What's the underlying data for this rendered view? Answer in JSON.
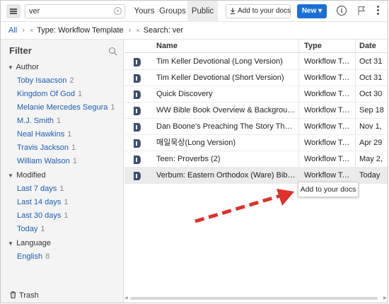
{
  "search": {
    "value": "ver"
  },
  "tabs": [
    {
      "label": "Yours",
      "active": false
    },
    {
      "label": "Groups",
      "active": false
    },
    {
      "label": "Public",
      "active": true
    }
  ],
  "toolbar": {
    "add_docs_label": "Add to your docs",
    "new_label": "New ▾",
    "info_glyph": "i",
    "accent_color": "#1a6fd6"
  },
  "breadcrumb": {
    "root": "All",
    "sep": "›",
    "filter_type": "Type: Workflow Template",
    "filter_search": "Search: ver",
    "remove_glyph": "×"
  },
  "sidebar": {
    "title": "Filter",
    "groups": [
      {
        "label": "Author",
        "items": [
          {
            "label": "Toby Isaacson",
            "count": "2"
          },
          {
            "label": "Kingdom Of God",
            "count": "1"
          },
          {
            "label": "Melanie  Mercedes Segura",
            "count": "1"
          },
          {
            "label": "M.J. Smith",
            "count": "1"
          },
          {
            "label": "Neal Hawkins",
            "count": "1"
          },
          {
            "label": "Travis Jackson",
            "count": "1"
          },
          {
            "label": "William Walson",
            "count": "1"
          }
        ]
      },
      {
        "label": "Modified",
        "items": [
          {
            "label": "Last 7 days",
            "count": "1"
          },
          {
            "label": "Last 14 days",
            "count": "1"
          },
          {
            "label": "Last 30 days",
            "count": "1"
          },
          {
            "label": "Today",
            "count": "1"
          }
        ]
      },
      {
        "label": "Language",
        "items": [
          {
            "label": "English",
            "count": "8"
          }
        ]
      }
    ],
    "trash_label": "Trash"
  },
  "table": {
    "columns": [
      "Name",
      "Type",
      "Date"
    ],
    "rows": [
      {
        "name": "Tim Keller Devotional (Long Version)",
        "type": "Workflow Template",
        "date": "Oct 31"
      },
      {
        "name": "Tim Keller Devotional (Short Version)",
        "type": "Workflow Template",
        "date": "Oct 31"
      },
      {
        "name": "Quick Discovery",
        "type": "Workflow Template",
        "date": "Oct 30"
      },
      {
        "name": "WW Bible Book Overview & Background Study",
        "type": "Workflow Template",
        "date": "Sep 18"
      },
      {
        "name": "Dan Boone's Preaching The Story That Shapes Us",
        "type": "Workflow Template",
        "date": "Nov 1,"
      },
      {
        "name": "매일묵상(Long Version)",
        "type": "Workflow Template",
        "date": "Apr 29"
      },
      {
        "name": "Teen: Proverbs (2)",
        "type": "Workflow Template",
        "date": "May 2,"
      },
      {
        "name": "Verbum: Eastern Orthodox (Ware) Bible Study",
        "type": "Workflow Template",
        "date": "Today"
      }
    ]
  },
  "tooltip": {
    "label": "Add to your docs"
  },
  "annotation": {
    "arrow_color": "#e0302a"
  }
}
